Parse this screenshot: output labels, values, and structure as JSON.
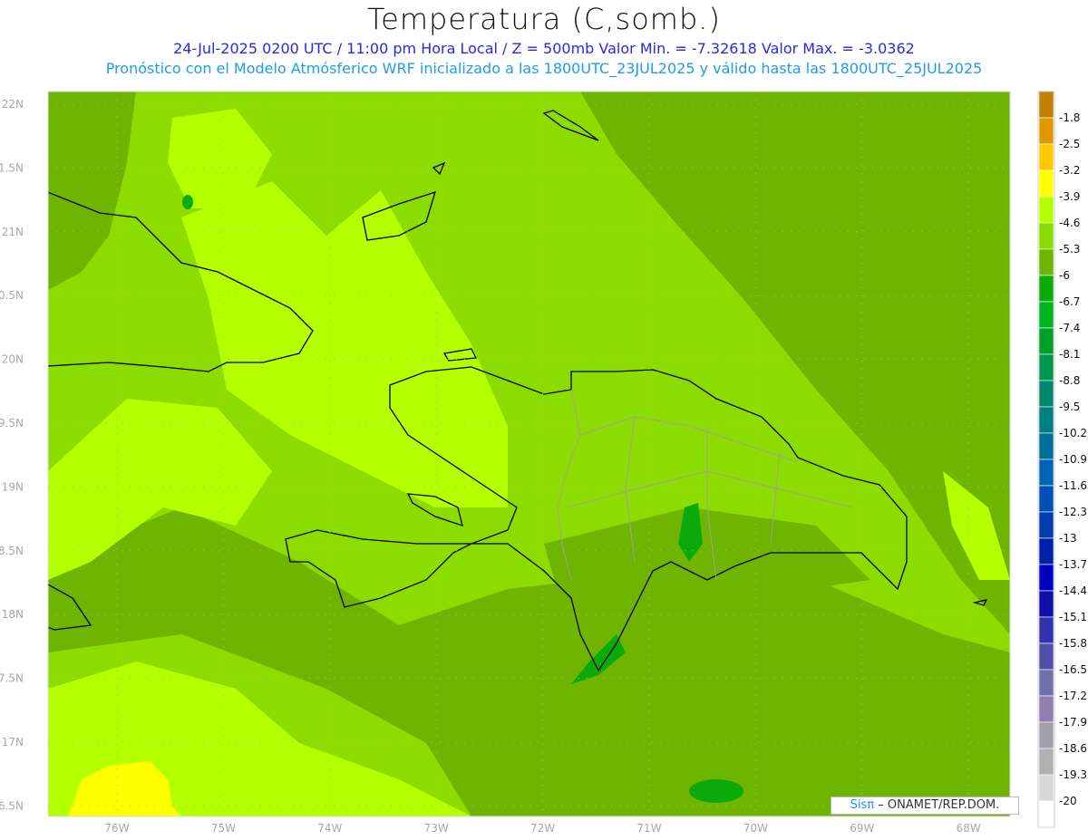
{
  "header": {
    "title": "Temperatura (C,somb.)",
    "line1": "24-Jul-2025  0200 UTC / 11:00 pm Hora Local / Z = 500mb  Valor Min. = -7.32618  Valor Max. = -3.0362",
    "line2": "Pronóstico con el Modelo Atmósferico WRF inicializado a las 1800UTC_23JUL2025 y válido hasta las  1800UTC_25JUL2025"
  },
  "axes": {
    "lon_labels": [
      "76W",
      "75W",
      "74W",
      "73W",
      "72W",
      "71W",
      "70W",
      "69W",
      "68W"
    ],
    "lat_labels": [
      "22N",
      "1.5N",
      "21N",
      "0.5N",
      "20N",
      "9.5N",
      "19N",
      "8.5N",
      "18N",
      "7.5N",
      "17N",
      "6.5N"
    ]
  },
  "colorbar": {
    "labels": [
      "-1.8",
      "-2.5",
      "-3.2",
      "-3.9",
      "-4.6",
      "-5.3",
      "-6",
      "-6.7",
      "-7.4",
      "-8.1",
      "-8.8",
      "-9.5",
      "-10.2",
      "-10.9",
      "-11.6",
      "-12.3",
      "-13",
      "-13.7",
      "-14.4",
      "-15.1",
      "-15.8",
      "-16.5",
      "-17.2",
      "-17.9",
      "-18.6",
      "-19.3",
      "-20"
    ],
    "colors": [
      "#c08000",
      "#e09800",
      "#ffc800",
      "#ffff00",
      "#b4ff00",
      "#8cdc00",
      "#6eb400",
      "#0aaa0a",
      "#00b41e",
      "#00a028",
      "#009650",
      "#00876e",
      "#007e80",
      "#00709a",
      "#0064b4",
      "#0050b4",
      "#003caa",
      "#0020aa",
      "#0000c0",
      "#1010a8",
      "#3232aa",
      "#5050a8",
      "#7070aa",
      "#9080b0",
      "#a0a0aa",
      "#b0b0b0",
      "#d8d8d8",
      "#ffffff"
    ]
  },
  "credit": {
    "brand": "Sisπ",
    "text": " – ONAMET/REP.DOM."
  }
}
